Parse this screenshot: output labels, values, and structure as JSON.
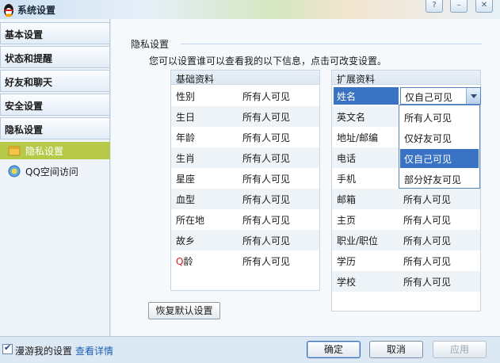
{
  "window": {
    "title": "系统设置"
  },
  "sidebar": {
    "categories": [
      {
        "label": "基本设置"
      },
      {
        "label": "状态和提醒"
      },
      {
        "label": "好友和聊天"
      },
      {
        "label": "安全设置"
      },
      {
        "label": "隐私设置"
      }
    ],
    "subitems": [
      {
        "label": "隐私设置",
        "active": true,
        "icon": "privacy-icon"
      },
      {
        "label": "QQ空间访问",
        "active": false,
        "icon": "qzone-icon"
      }
    ]
  },
  "main": {
    "section_title": "隐私设置",
    "description": "您可以设置谁可以查看我的以下信息，点击可改变设置。",
    "basic_group": {
      "header": "基础资料",
      "rows": [
        {
          "label": "性别",
          "value": "所有人可见"
        },
        {
          "label": "生日",
          "value": "所有人可见"
        },
        {
          "label": "年龄",
          "value": "所有人可见"
        },
        {
          "label": "生肖",
          "value": "所有人可见"
        },
        {
          "label": "星座",
          "value": "所有人可见"
        },
        {
          "label": "血型",
          "value": "所有人可见"
        },
        {
          "label": "所在地",
          "value": "所有人可见"
        },
        {
          "label": "故乡",
          "value": "所有人可见"
        },
        {
          "label_prefix": "Q",
          "label": "龄",
          "value": "所有人可见"
        }
      ]
    },
    "extended_group": {
      "header": "扩展资料",
      "rows": [
        {
          "label": "姓名",
          "value": "仅自己可见"
        },
        {
          "label": "英文名",
          "value": ""
        },
        {
          "label": "地址/邮编",
          "value": ""
        },
        {
          "label": "电话",
          "value": ""
        },
        {
          "label": "手机",
          "value": ""
        },
        {
          "label": "邮箱",
          "value": "所有人可见"
        },
        {
          "label": "主页",
          "value": "所有人可见"
        },
        {
          "label": "职业/职位",
          "value": "所有人可见"
        },
        {
          "label": "学历",
          "value": "所有人可见"
        },
        {
          "label": "学校",
          "value": "所有人可见"
        }
      ]
    },
    "dropdown": {
      "options": [
        "所有人可见",
        "仅好友可见",
        "仅自己可见",
        "部分好友可见"
      ],
      "highlighted_index": 2
    },
    "restore_button": "恢复默认设置"
  },
  "bottom": {
    "roam_checkbox_label": "漫游我的设置",
    "roam_checked": true,
    "details_link": "查看详情",
    "ok": "确定",
    "cancel": "取消",
    "apply": "应用"
  },
  "colors": {
    "accent": "#3a72c4",
    "active_sidebar": "#b6c949",
    "link": "#1c5fb5"
  }
}
